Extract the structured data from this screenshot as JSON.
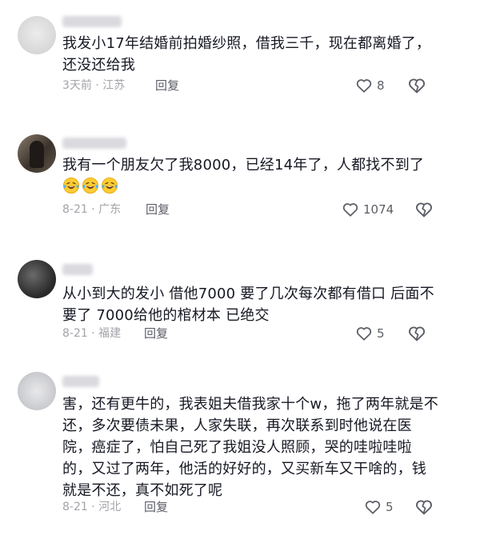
{
  "comments": [
    {
      "text": "我发小17年结婚前拍婚纱照，借我三千，现在都离婚了，还没还给我",
      "emojis": [],
      "date": "3天前",
      "location": "江苏",
      "reply_label": "回复",
      "likes": "8"
    },
    {
      "text": "我有一个朋友欠了我8000，已经14年了，人都找不到了",
      "emojis": [
        "laughing-crying-emoji",
        "laughing-crying-emoji",
        "laughing-crying-emoji"
      ],
      "date": "8-21",
      "location": "广东",
      "reply_label": "回复",
      "likes": "1074"
    },
    {
      "text": "从小到大的发小 借他7000 要了几次每次都有借口 后面不要了 7000给他的棺材本 已绝交",
      "emojis": [],
      "date": "8-21",
      "location": "福建",
      "reply_label": "回复",
      "likes": "5"
    },
    {
      "text": "害，还有更牛的，我表姐夫借我家十个w，拖了两年就是不还，多次要债未果，人家失联，再次联系到时他说在医院，癌症了，怕自己死了我姐没人照顾，哭的哇啦哇啦的，又过了两年，他活的好好的，又买新车又干啥的，钱就是不还，真不如死了呢",
      "emojis": [],
      "date": "8-21",
      "location": "河北",
      "reply_label": "回复",
      "likes": "5"
    }
  ],
  "icons": {
    "like": "heart-outline-icon",
    "dislike": "broken-heart-icon"
  },
  "colors": {
    "text": "#161823",
    "meta": "#a2a3a8",
    "action": "#5c5e66"
  }
}
